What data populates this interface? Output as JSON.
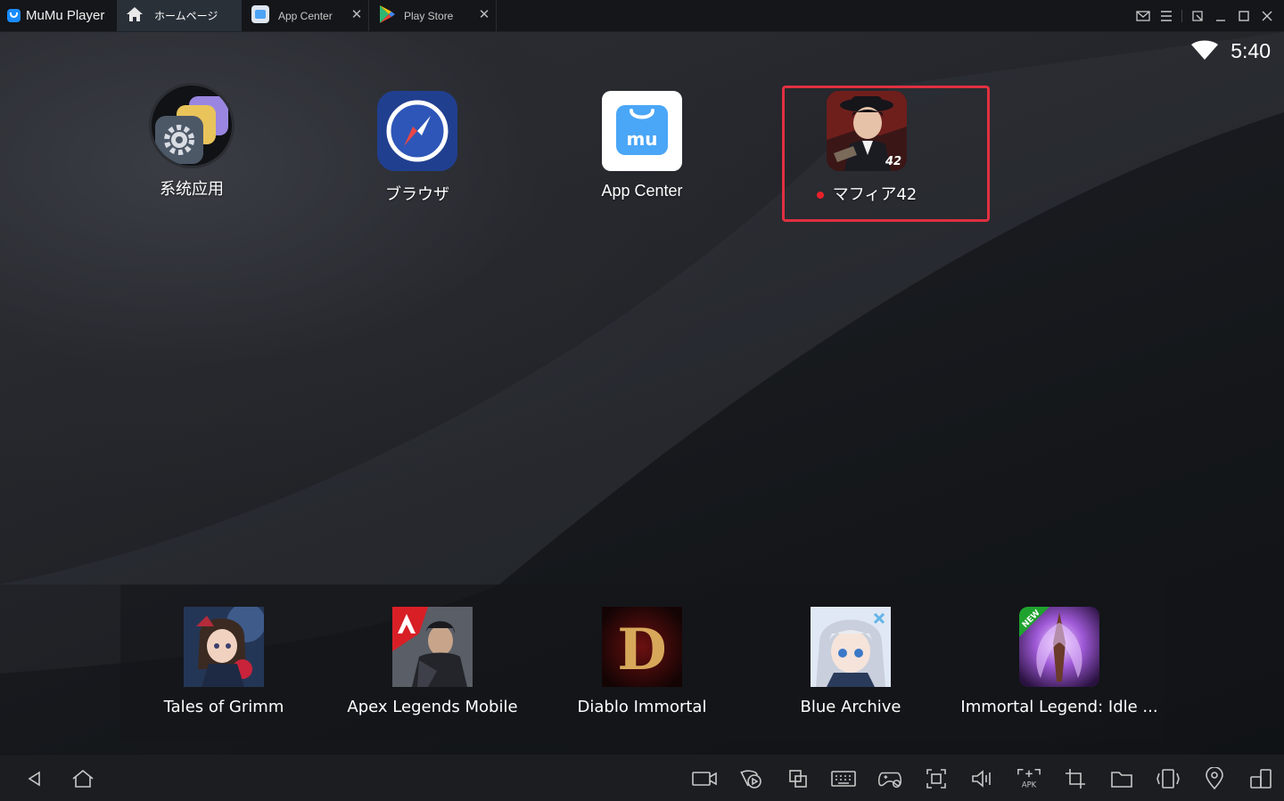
{
  "window": {
    "app_name": "MuMu Player",
    "tabs": [
      {
        "label": "ホームページ",
        "icon": "home-icon",
        "active": true
      },
      {
        "label": "App Center",
        "icon": "app-center-icon",
        "active": false
      },
      {
        "label": "Play Store",
        "icon": "play-store-icon",
        "active": false
      }
    ],
    "controls": [
      "mail-icon",
      "menu-icon",
      "pin-icon",
      "minimize-icon",
      "maximize-icon",
      "close-icon"
    ]
  },
  "status_bar": {
    "time": "5:40",
    "wifi": "wifi-icon"
  },
  "desktop": {
    "apps": [
      {
        "label": "系统应用",
        "icon": "system-apps-icon"
      },
      {
        "label": "ブラウザ",
        "icon": "browser-icon"
      },
      {
        "label": "App Center",
        "icon": "app-center-icon"
      },
      {
        "label": "マフィア42",
        "icon": "mafia42-icon",
        "new_indicator": true,
        "highlighted": true
      }
    ]
  },
  "dock": {
    "apps": [
      {
        "label": "Tales of Grimm",
        "icon": "tales-of-grimm-icon"
      },
      {
        "label": "Apex Legends Mobile",
        "icon": "apex-legends-icon"
      },
      {
        "label": "Diablo Immortal",
        "icon": "diablo-immortal-icon"
      },
      {
        "label": "Blue Archive",
        "icon": "blue-archive-icon"
      },
      {
        "label": "Immortal Legend: Idle ...",
        "icon": "immortal-legend-icon",
        "badge": "NEW"
      }
    ]
  },
  "toolbar": {
    "left": [
      "back-icon",
      "home-icon"
    ],
    "right": [
      "record-video-icon",
      "operation-record-icon",
      "multi-instance-icon",
      "keyboard-icon",
      "gamepad-icon",
      "screenshot-icon",
      "volume-icon",
      "apk-install-icon",
      "crop-icon",
      "folder-icon",
      "shake-icon",
      "location-icon",
      "rotate-icon"
    ]
  },
  "colors": {
    "highlight": "#e03040",
    "new_dot": "#e8202a",
    "titlebar": "#141619",
    "active_tab": "#2a3038"
  }
}
